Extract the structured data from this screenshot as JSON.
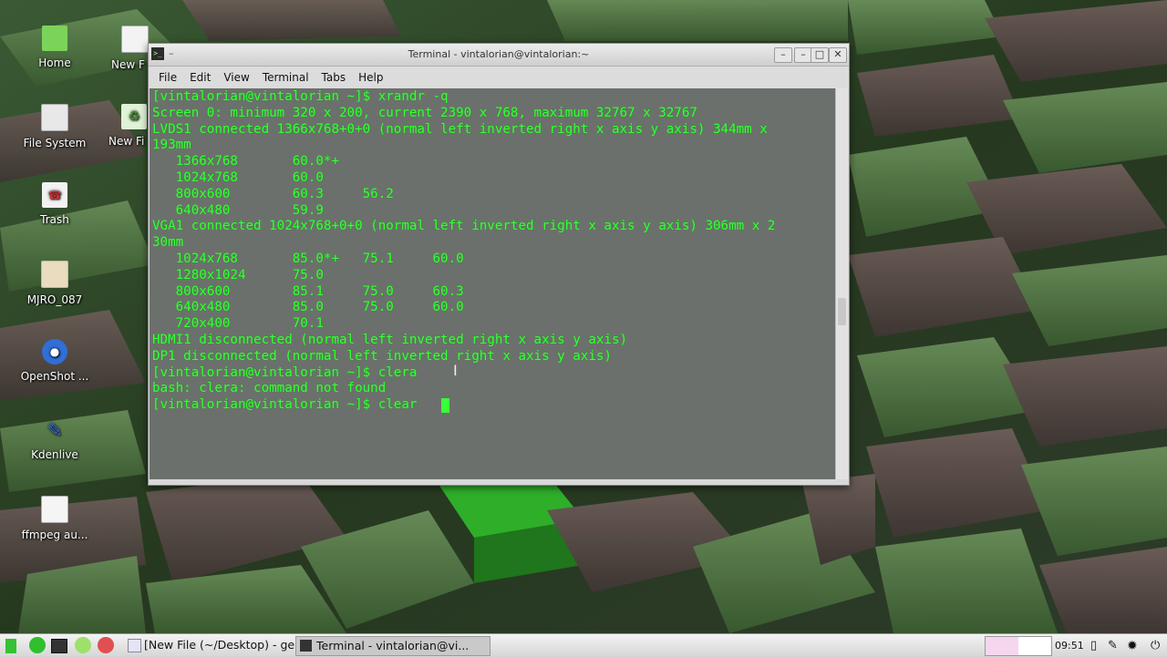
{
  "desktop": {
    "icons": [
      {
        "label": "Home"
      },
      {
        "label": "File System"
      },
      {
        "label": "Trash"
      },
      {
        "label": "MJRO_087"
      },
      {
        "label": "OpenShot ..."
      },
      {
        "label": "Kdenlive"
      },
      {
        "label": "ffmpeg au..."
      },
      {
        "label": "New F"
      },
      {
        "label": "New Fi"
      }
    ]
  },
  "terminal": {
    "title": "Terminal - vintalorian@vintalorian:~",
    "menu": [
      "File",
      "Edit",
      "View",
      "Terminal",
      "Tabs",
      "Help"
    ],
    "lines": [
      "[vintalorian@vintalorian ~]$ xrandr -q",
      "Screen 0: minimum 320 x 200, current 2390 x 768, maximum 32767 x 32767",
      "LVDS1 connected 1366x768+0+0 (normal left inverted right x axis y axis) 344mm x",
      "193mm",
      "   1366x768       60.0*+",
      "   1024x768       60.0",
      "   800x600        60.3     56.2",
      "   640x480        59.9",
      "VGA1 connected 1024x768+0+0 (normal left inverted right x axis y axis) 306mm x 2",
      "30mm",
      "   1024x768       85.0*+   75.1     60.0",
      "   1280x1024      75.0",
      "   800x600        85.1     75.0     60.3",
      "   640x480        85.0     75.0     60.0",
      "   720x400        70.1",
      "HDMI1 disconnected (normal left inverted right x axis y axis)",
      "DP1 disconnected (normal left inverted right x axis y axis)",
      "[vintalorian@vintalorian ~]$ clera",
      "bash: clera: command not found",
      "[vintalorian@vintalorian ~]$ clear"
    ]
  },
  "taskbar": {
    "tasks": [
      {
        "label": "[New File (~/Desktop) - ge..."
      },
      {
        "label": "Terminal - vintalorian@vi..."
      }
    ],
    "clock": "09:51"
  },
  "colors": {
    "terminal_text": "#38ff38",
    "wallpaper_dark": "#1f2d1f",
    "wallpaper_block": "#4f8a3f"
  }
}
